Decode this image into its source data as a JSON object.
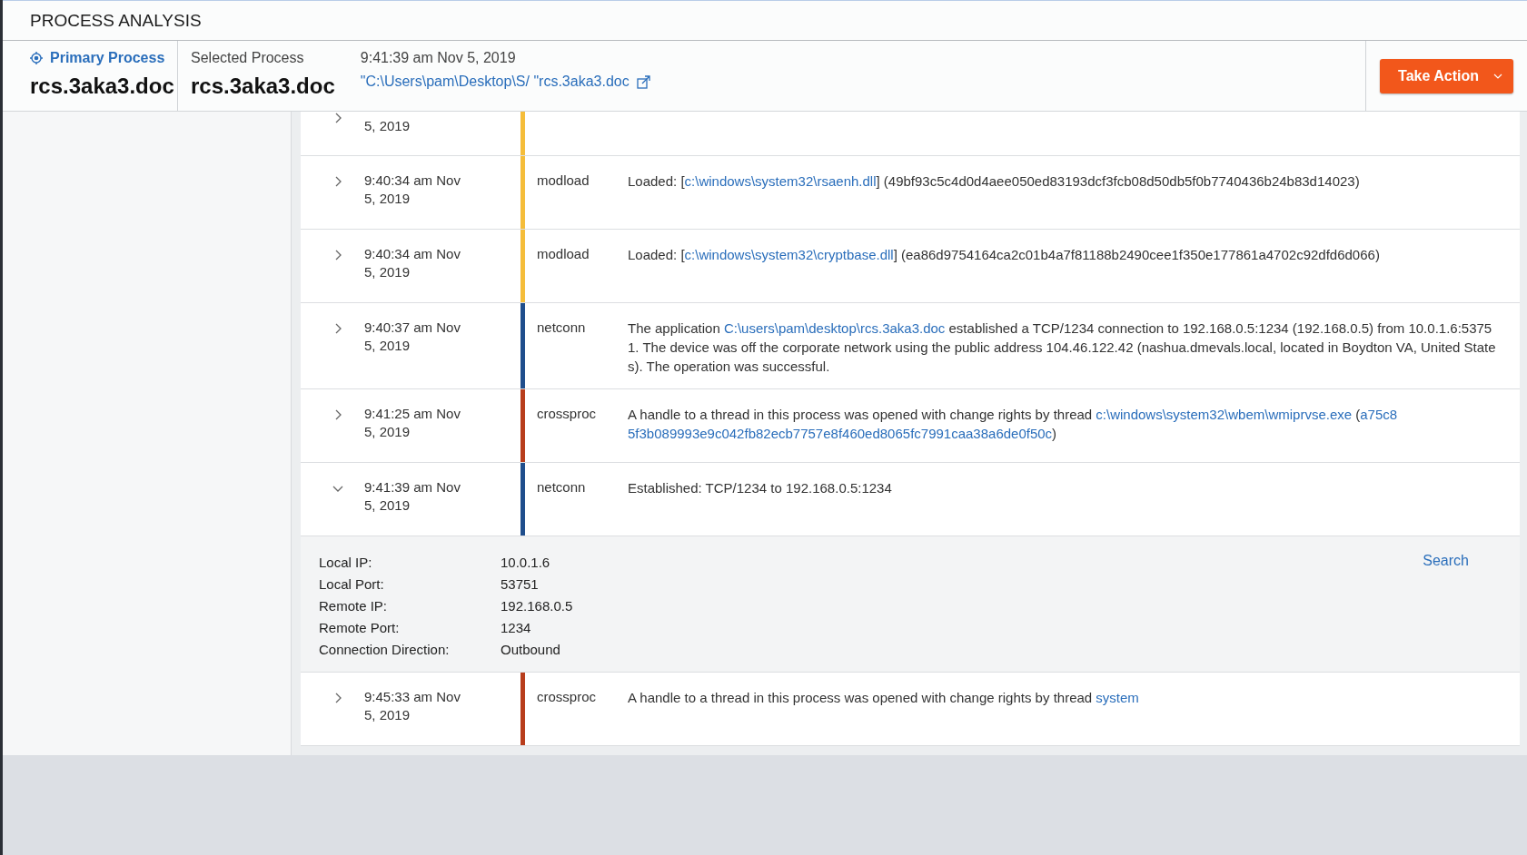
{
  "title": "PROCESS ANALYSIS",
  "primary": {
    "label": "Primary Process",
    "name": "rcs.3aka3.doc"
  },
  "selected": {
    "label": "Selected Process",
    "name": "rcs.3aka3.doc",
    "time": "9:41:39 am Nov 5, 2019",
    "path": "\"C:\\Users\\pam\\Desktop\\S/ \"rcs.3aka3.doc"
  },
  "action_button": "Take Action",
  "events": [
    {
      "kind": "partial",
      "expanded": false,
      "time": "5, 2019",
      "color": "#f5bd3a"
    },
    {
      "kind": "event",
      "expanded": false,
      "time": "9:40:34 am Nov 5, 2019",
      "type": "modload",
      "color": "#f5bd3a",
      "description": [
        {
          "text": "Loaded: ["
        },
        {
          "link": "c:\\windows\\system32\\rsaenh.dll"
        },
        {
          "text": "] (49bf93c5c4d0d4aee050ed83193dcf3fcb08d50db5f0b7740436b24b83d14023)"
        }
      ]
    },
    {
      "kind": "event",
      "expanded": false,
      "time": "9:40:34 am Nov 5, 2019",
      "type": "modload",
      "color": "#f5bd3a",
      "description": [
        {
          "text": "Loaded: ["
        },
        {
          "link": "c:\\windows\\system32\\cryptbase.dll"
        },
        {
          "text": "] (ea86d9754164ca2c01b4a7f81188b2490cee1f350e177861a4702c92dfd6d066)"
        }
      ]
    },
    {
      "kind": "event",
      "expanded": false,
      "time": "9:40:37 am Nov 5, 2019",
      "type": "netconn",
      "color": "#1f4e8c",
      "description": [
        {
          "text": "The application "
        },
        {
          "link": "C:\\users\\pam\\desktop\\rcs.3aka3.doc"
        },
        {
          "text": " established a TCP/1234 connection to 192.168.0.5:1234 (192.168.0.5) from 10.0.1.6:53751. The device was off the corporate network using the public address 104.46.122.42 (nashua.dmevals.local, located in Boydton VA, United States). The operation was successful."
        }
      ]
    },
    {
      "kind": "event",
      "expanded": false,
      "time": "9:41:25 am Nov 5, 2019",
      "type": "crossproc",
      "color": "#b83d1c",
      "description": [
        {
          "text": "A handle to a thread in this process was opened with change rights by thread "
        },
        {
          "link": "c:\\windows\\system32\\wbem\\wmiprvse.exe"
        },
        {
          "text": " ("
        },
        {
          "link": "a75c8"
        },
        {
          "link": "5f3b089993e9c042fb82ecb7757e8f460ed8065fc7991caa38a6de0f50c"
        },
        {
          "text": ")"
        }
      ]
    },
    {
      "kind": "event",
      "expanded": true,
      "time": "9:41:39 am Nov 5, 2019",
      "type": "netconn",
      "color": "#1f4e8c",
      "description": [
        {
          "text": "Established: TCP/1234 to 192.168.0.5:1234"
        }
      ],
      "details": {
        "search": "Search",
        "fields": [
          {
            "label": "Local IP:",
            "value": "10.0.1.6"
          },
          {
            "label": "Local Port:",
            "value": "53751"
          },
          {
            "label": "Remote IP:",
            "value": "192.168.0.5"
          },
          {
            "label": "Remote Port:",
            "value": "1234"
          },
          {
            "label": "Connection Direction:",
            "value": "Outbound"
          }
        ]
      }
    },
    {
      "kind": "event",
      "expanded": false,
      "time": "9:45:33 am Nov 5, 2019",
      "type": "crossproc",
      "color": "#b83d1c",
      "description": [
        {
          "text": "A handle to a thread in this process was opened with change rights by thread "
        },
        {
          "link": "system"
        }
      ]
    }
  ]
}
